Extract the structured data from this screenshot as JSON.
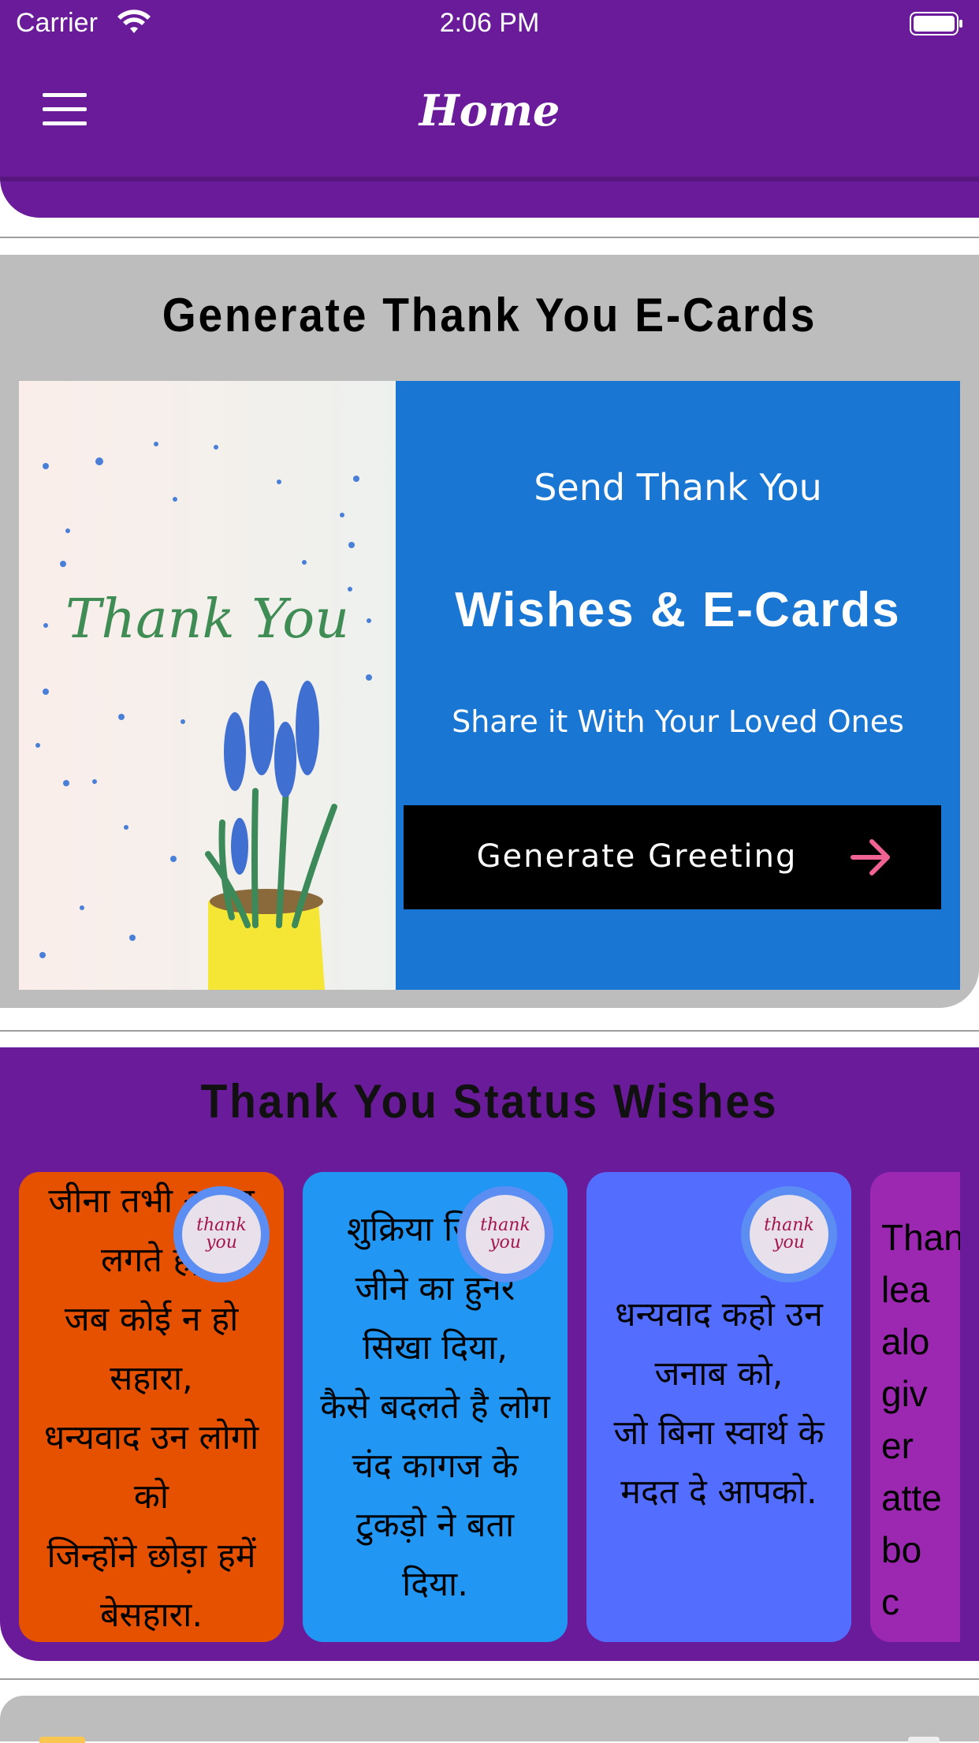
{
  "status_bar": {
    "carrier": "Carrier",
    "time": "2:06 PM",
    "wifi_icon": "wifi-icon",
    "battery_icon": "battery-icon"
  },
  "header": {
    "title": "Home",
    "menu_icon": "hamburger-menu-icon",
    "color": "#6a1b9a"
  },
  "ecard_section": {
    "heading": "Generate Thank You E-Cards",
    "image": {
      "text": "Thank You"
    },
    "promo": {
      "line1": "Send Thank You",
      "line2": "Wishes & E-Cards",
      "line3": "Share it With Your Loved Ones",
      "button_label": "Generate Greeting",
      "button_icon": "arrow-right-icon"
    },
    "colors": {
      "background": "#bdbdbd",
      "promo": "#1976d2",
      "button": "#000000",
      "arrow": "#f06292"
    }
  },
  "status_section": {
    "heading": "Thank You Status Wishes",
    "badge_text": "thank you",
    "cards": [
      {
        "text": "जीना तभी अच्छा लगते है,\nजब कोई न हो सहारा,\nधन्यवाद उन लोगो को\nजिन्होंने छोड़ा हमें बेसहारा.",
        "color": "#e65100"
      },
      {
        "text": "शुक्रिया जिंदगी\nजीने का हुनर\nसिखा दिया,\nकैसे बदलते है लोग\nचंद कागज के\nटुकड़ो ने बता\nदिया.",
        "color": "#2196f3"
      },
      {
        "text": "धन्यवाद कहो उन\nजनाब को,\nजो बिना स्वार्थ के\nमदत दे आपको.",
        "color": "#536dfe"
      },
      {
        "text": "Thank\nlea\nalo\ngiv\ner\natte\nbo\nc",
        "color": "#9c27b0"
      }
    ]
  }
}
